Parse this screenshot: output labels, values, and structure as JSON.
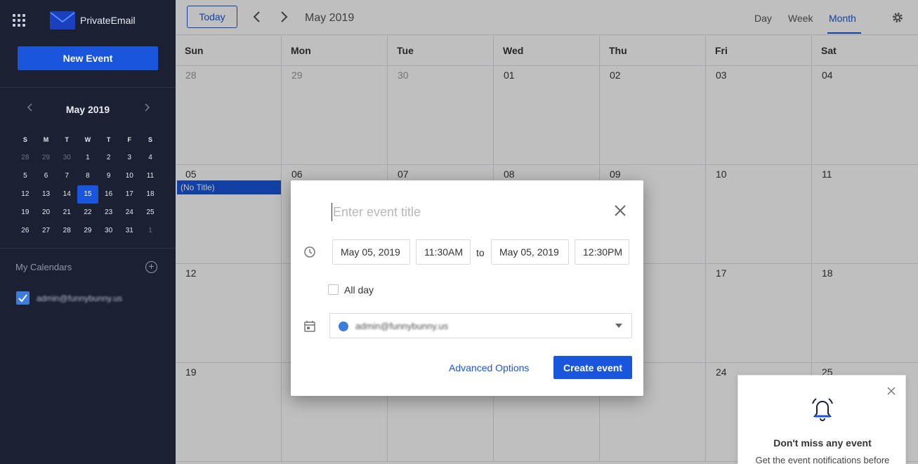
{
  "app": {
    "logo_text": "PrivateEmail"
  },
  "sidebar": {
    "new_event_label": "New Event",
    "mini_calendar": {
      "title": "May 2019",
      "dow": [
        "S",
        "M",
        "T",
        "W",
        "T",
        "F",
        "S"
      ],
      "weeks": [
        [
          "28",
          "29",
          "30",
          "1",
          "2",
          "3",
          "4"
        ],
        [
          "5",
          "6",
          "7",
          "8",
          "9",
          "10",
          "11"
        ],
        [
          "12",
          "13",
          "14",
          "15",
          "16",
          "17",
          "18"
        ],
        [
          "19",
          "20",
          "21",
          "22",
          "23",
          "24",
          "25"
        ],
        [
          "26",
          "27",
          "28",
          "29",
          "30",
          "31",
          "1"
        ]
      ],
      "today": "15"
    },
    "my_calendars_label": "My Calendars",
    "calendar_email": "admin@funnybunny.us"
  },
  "toolbar": {
    "today_label": "Today",
    "month_title": "May 2019",
    "views": {
      "day": "Day",
      "week": "Week",
      "month": "Month"
    }
  },
  "calendar": {
    "dow": [
      "Sun",
      "Mon",
      "Tue",
      "Wed",
      "Thu",
      "Fri",
      "Sat"
    ],
    "weeks": [
      [
        "28",
        "29",
        "30",
        "01",
        "02",
        "03",
        "04"
      ],
      [
        "05",
        "06",
        "07",
        "08",
        "09",
        "10",
        "11"
      ],
      [
        "12",
        "",
        "",
        "",
        "",
        "17",
        "18"
      ],
      [
        "19",
        "",
        "",
        "",
        "",
        "24",
        "25"
      ]
    ],
    "event_chip": "(No Title)"
  },
  "dialog": {
    "title_placeholder": "Enter event title",
    "start_date": "May 05, 2019",
    "start_time": "11:30AM",
    "to_label": "to",
    "end_date": "May 05, 2019",
    "end_time": "12:30PM",
    "all_day_label": "All day",
    "calendar_value": "admin@funnybunny.us",
    "calendar_color": "#3b7ddd",
    "advanced_label": "Advanced Options",
    "create_label": "Create event"
  },
  "notification": {
    "title": "Don't miss any event",
    "subtitle": "Get the event notifications before"
  },
  "colors": {
    "accent": "#1a56db",
    "sidebar_bg": "#1c2033"
  }
}
